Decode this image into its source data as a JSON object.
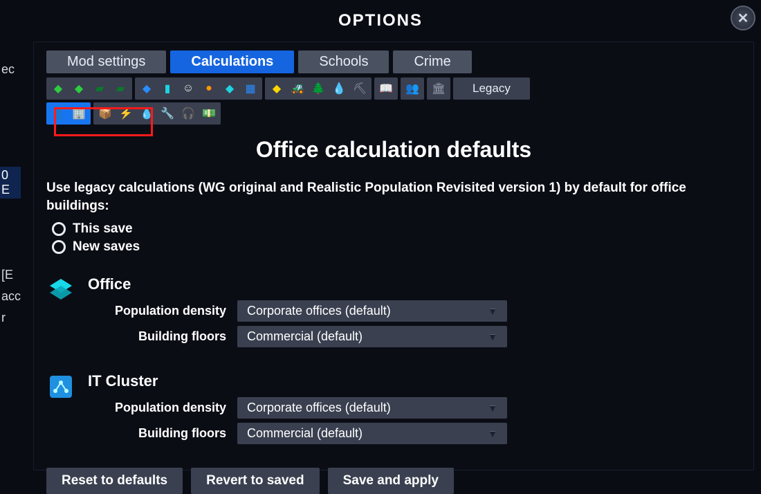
{
  "window": {
    "title": "OPTIONS"
  },
  "tabs": [
    {
      "label": "Mod settings",
      "active": false
    },
    {
      "label": "Calculations",
      "active": true
    },
    {
      "label": "Schools",
      "active": false
    },
    {
      "label": "Crime",
      "active": false
    }
  ],
  "legacy_button_label": "Legacy",
  "page_heading": "Office calculation defaults",
  "legacy_description": "Use legacy calculations (WG original and Realistic Population Revisited version 1) by default for office buildings:",
  "radio_options": [
    {
      "label": "This save"
    },
    {
      "label": "New saves"
    }
  ],
  "sections": [
    {
      "title": "Office",
      "icon": "office-icon",
      "fields": [
        {
          "label": "Population density",
          "value": "Corporate offices (default)"
        },
        {
          "label": "Building floors",
          "value": "Commercial (default)"
        }
      ]
    },
    {
      "title": "IT Cluster",
      "icon": "it-cluster-icon",
      "fields": [
        {
          "label": "Population density",
          "value": "Corporate offices (default)"
        },
        {
          "label": "Building floors",
          "value": "Commercial (default)"
        }
      ]
    }
  ],
  "footer_buttons": [
    {
      "label": "Reset to defaults"
    },
    {
      "label": "Revert to saved"
    },
    {
      "label": "Save and apply"
    }
  ],
  "left_strip": {
    "t1": "ec",
    "t2": "0 E",
    "t3": "[E",
    "t4": "acc",
    "t5": "r"
  }
}
